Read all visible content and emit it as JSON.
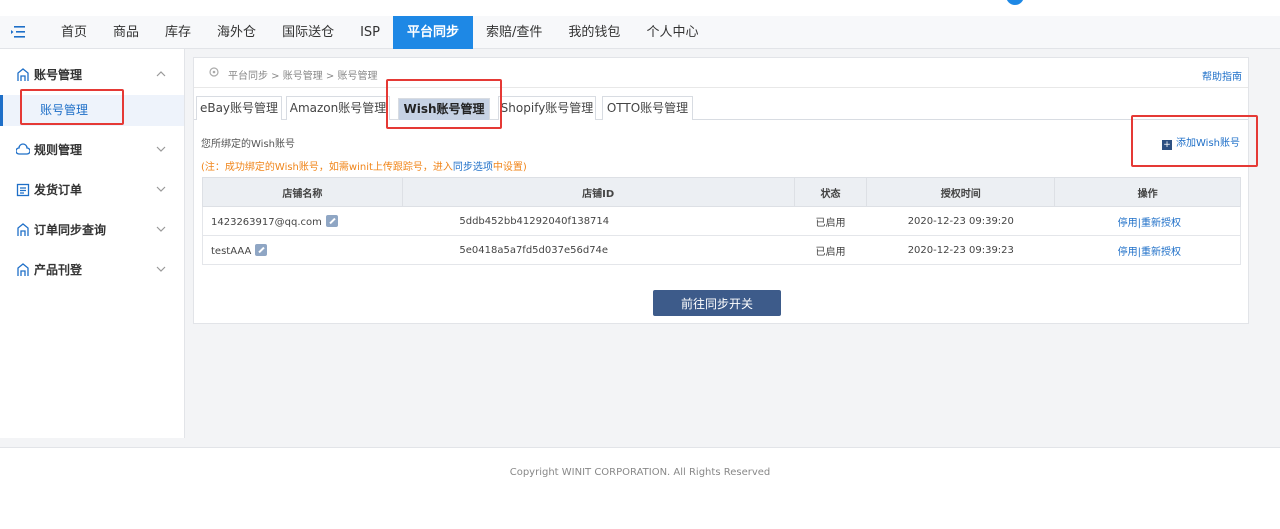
{
  "nav": {
    "items": [
      {
        "label": "首页"
      },
      {
        "label": "商品"
      },
      {
        "label": "库存"
      },
      {
        "label": "海外仓"
      },
      {
        "label": "国际送仓"
      },
      {
        "label": "ISP"
      },
      {
        "label": "平台同步",
        "active": true
      },
      {
        "label": "索赔/查件"
      },
      {
        "label": "我的钱包"
      },
      {
        "label": "个人中心"
      }
    ]
  },
  "sidebar": {
    "groups": [
      {
        "label": "账号管理",
        "icon": "account-icon",
        "expanded": true,
        "sub": {
          "label": "账号管理"
        }
      },
      {
        "label": "规则管理",
        "icon": "rules-icon"
      },
      {
        "label": "发货订单",
        "icon": "order-icon"
      },
      {
        "label": "订单同步查询",
        "icon": "sync-query-icon"
      },
      {
        "label": "产品刊登",
        "icon": "listing-icon"
      }
    ]
  },
  "breadcrumb": {
    "text": "平台同步 > 账号管理 > 账号管理",
    "help": "帮助指南"
  },
  "tabs": [
    {
      "label": "eBay账号管理"
    },
    {
      "label": "Amazon账号管理"
    },
    {
      "label": "Wish账号管理",
      "active": true
    },
    {
      "label": "Shopify账号管理"
    },
    {
      "label": "OTTO账号管理"
    }
  ],
  "panel": {
    "bound_label": "您所绑定的Wish账号",
    "note_prefix": "(注：成功绑定的Wish账号，如需winit上传跟踪号，进入",
    "note_link": "同步选项",
    "note_suffix": "中设置)",
    "add_label": "添加Wish账号"
  },
  "table": {
    "headers": [
      "店铺名称",
      "店铺ID",
      "状态",
      "授权时间",
      "操作"
    ],
    "rows": [
      {
        "name": "1423263917@qq.com",
        "id": "5ddb452bb41292040f138714",
        "status": "已启用",
        "time": "2020-12-23 09:39:20",
        "op1": "停用",
        "sep": "|",
        "op2": "重新授权"
      },
      {
        "name": "testAAA",
        "id": "5e0418a5a7fd5d037e56d74e",
        "status": "已启用",
        "time": "2020-12-23 09:39:23",
        "op1": "停用",
        "sep": "|",
        "op2": "重新授权"
      }
    ]
  },
  "sync_button": "前往同步开关",
  "footer": {
    "copyright": "Copyright WINIT CORPORATION. All Rights Reserved"
  },
  "colors": {
    "accent": "#1e88e5",
    "link": "#1e6fc8",
    "note": "#f0851a",
    "highlight_box": "#e53935",
    "primary_button": "#3d5b8a"
  }
}
